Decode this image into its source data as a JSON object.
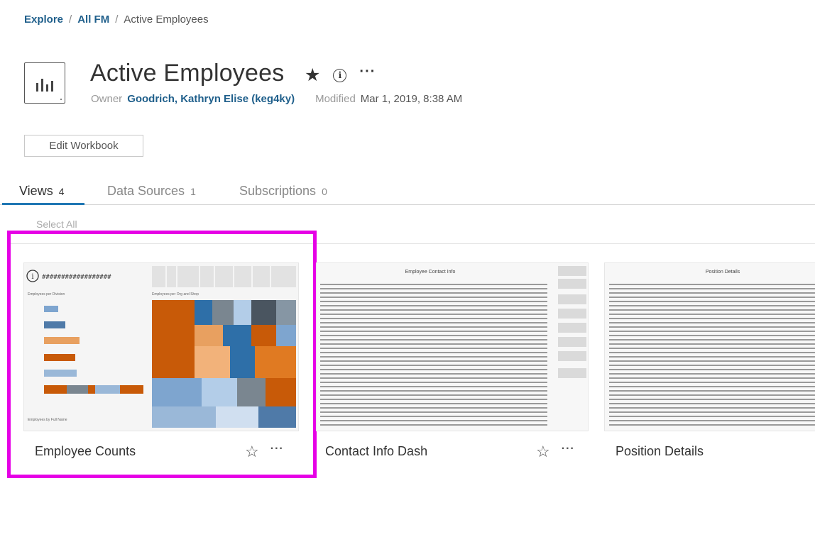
{
  "breadcrumb": {
    "explore": "Explore",
    "sep1": "/",
    "all_fm": "All FM",
    "sep2": "/",
    "current": "Active Employees"
  },
  "workbook": {
    "title": "Active Employees",
    "owner_label": "Owner",
    "owner_name": "Goodrich, Kathryn Elise (keg4ky)",
    "modified_label": "Modified",
    "modified_value": "Mar 1, 2019, 8:38 AM"
  },
  "icons": {
    "favorite": "star-filled-icon",
    "info": "info-circle-icon",
    "more": "more-dots-icon"
  },
  "actions": {
    "edit_workbook": "Edit Workbook",
    "select_all": "Select All"
  },
  "tabs": [
    {
      "label": "Views",
      "count": "4",
      "active": true
    },
    {
      "label": "Data Sources",
      "count": "1",
      "active": false
    },
    {
      "label": "Subscriptions",
      "count": "0",
      "active": false
    }
  ],
  "views": [
    {
      "name": "Employee Counts",
      "selected": true
    },
    {
      "name": "Contact Info Dash",
      "selected": false,
      "thumb_title": "Employee Contact Info"
    },
    {
      "name": "Position Details",
      "selected": false,
      "thumb_title": "Position Details"
    }
  ],
  "colors": {
    "link": "#1f5f8b",
    "accent": "#1f77b4",
    "selection": "#e600e6",
    "orange": "#c85a08",
    "blue": "#2e6fa8"
  }
}
